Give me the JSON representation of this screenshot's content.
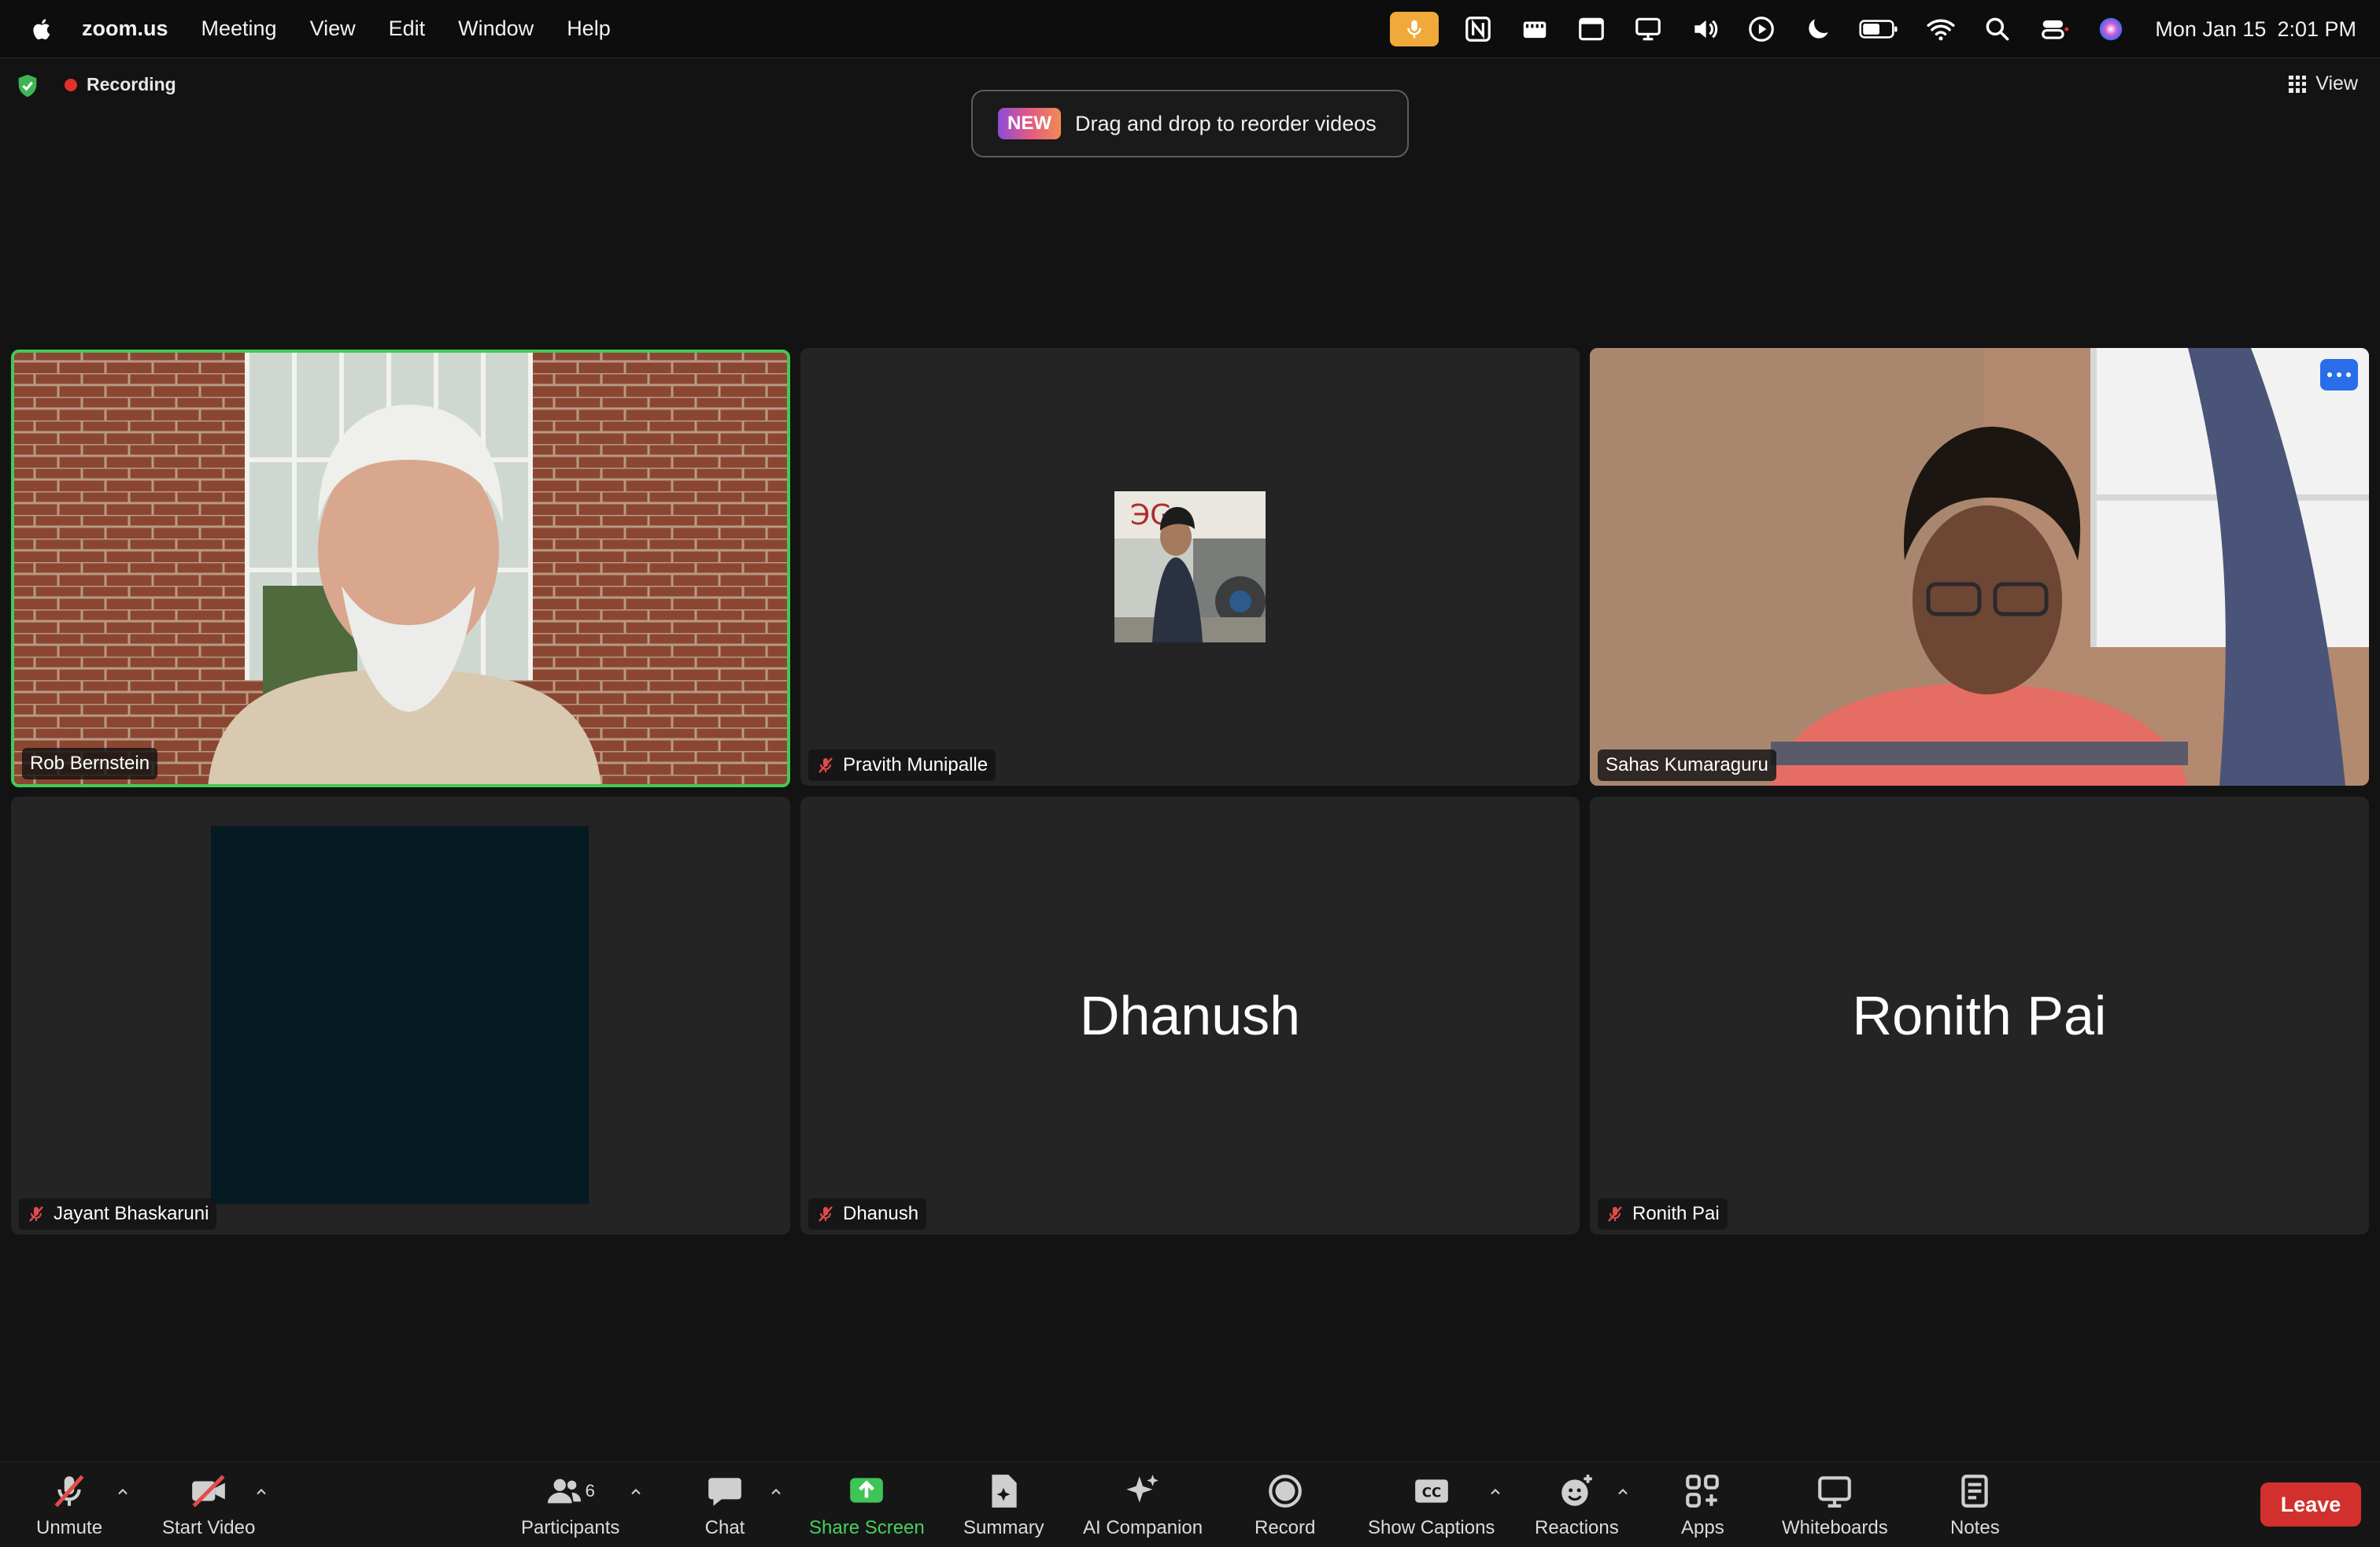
{
  "menubar": {
    "app": "zoom.us",
    "items": [
      "Meeting",
      "View",
      "Edit",
      "Window",
      "Help"
    ],
    "date": "Mon Jan 15",
    "time": "2:01 PM"
  },
  "meeting": {
    "recording_label": "Recording",
    "view_label": "View",
    "toast_badge": "NEW",
    "toast_text": "Drag and drop to reorder videos"
  },
  "participants": [
    {
      "name": "Rob Bernstein",
      "muted": false,
      "video": "on",
      "active_speaker": true
    },
    {
      "name": "Pravith Munipalle",
      "muted": true,
      "video": "avatar"
    },
    {
      "name": "Sahas Kumaraguru",
      "muted": false,
      "video": "on"
    },
    {
      "name": "Jayant Bhaskaruni",
      "muted": true,
      "video": "dark"
    },
    {
      "name": "Dhanush",
      "muted": true,
      "video": "off",
      "display_name": "Dhanush"
    },
    {
      "name": "Ronith Pai",
      "muted": true,
      "video": "off",
      "display_name": "Ronith Pai"
    }
  ],
  "toolbar": {
    "unmute": "Unmute",
    "start_video": "Start Video",
    "participants": "Participants",
    "participants_count": "6",
    "chat": "Chat",
    "share_screen": "Share Screen",
    "summary": "Summary",
    "ai_companion": "AI Companion",
    "record": "Record",
    "show_captions": "Show Captions",
    "reactions": "Reactions",
    "apps": "Apps",
    "whiteboards": "Whiteboards",
    "notes": "Notes",
    "leave": "Leave"
  },
  "colors": {
    "active_speaker_border": "#44c85a",
    "share_screen": "#46d15c",
    "leave": "#d2302d",
    "recording_dot": "#e0312f"
  }
}
